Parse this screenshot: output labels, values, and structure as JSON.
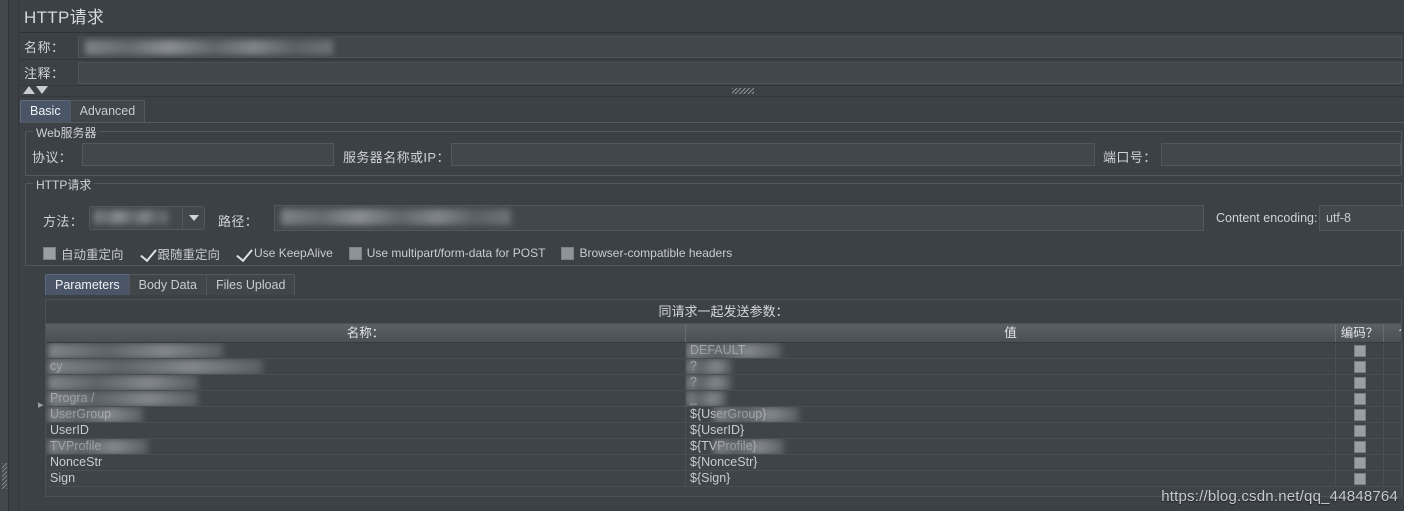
{
  "window": {
    "title": "HTTP请求",
    "watermark": "https://blog.csdn.net/qq_44848764"
  },
  "header": {
    "name_label": "名称：",
    "name_value": "",
    "comment_label": "注释：",
    "comment_value": ""
  },
  "main_tabs": [
    {
      "label": "Basic",
      "selected": true
    },
    {
      "label": "Advanced",
      "selected": false
    }
  ],
  "web_server": {
    "group_title": "Web服务器",
    "protocol_label": "协议：",
    "protocol_value": "",
    "host_label": "服务器名称或IP：",
    "host_value": "",
    "port_label": "端口号：",
    "port_value": ""
  },
  "http_request": {
    "group_title": "HTTP请求",
    "method_label": "方法：",
    "method_value": "",
    "path_label": "路径：",
    "path_value": "",
    "content_encoding_label": "Content encoding:",
    "content_encoding_value": "utf-8"
  },
  "options": [
    {
      "label": "自动重定向",
      "checked": false,
      "cjk": true
    },
    {
      "label": "跟随重定向",
      "checked": true,
      "cjk": true
    },
    {
      "label": "Use KeepAlive",
      "checked": true,
      "cjk": false
    },
    {
      "label": "Use multipart/form-data for POST",
      "checked": false,
      "cjk": false
    },
    {
      "label": "Browser-compatible headers",
      "checked": false,
      "cjk": false
    }
  ],
  "param_tabs": [
    {
      "label": "Parameters",
      "selected": true
    },
    {
      "label": "Body Data",
      "selected": false
    },
    {
      "label": "Files Upload",
      "selected": false
    }
  ],
  "params_table": {
    "caption": "同请求一起发送参数：",
    "columns": [
      "名称：",
      "值",
      "编码？",
      "包含等"
    ],
    "rows": [
      {
        "name": "",
        "value": "DEFAULT",
        "name_blurred": true,
        "value_blurred": true,
        "encode": false,
        "include": true
      },
      {
        "name": "       cy",
        "value": "?",
        "name_blurred": true,
        "value_blurred": true,
        "encode": false,
        "include": true
      },
      {
        "name": "",
        "value": "?",
        "name_blurred": true,
        "value_blurred": true,
        "encode": false,
        "include": true
      },
      {
        "name": "Progra     /",
        "value": "_",
        "name_blurred": true,
        "value_blurred": true,
        "encode": false,
        "include": true
      },
      {
        "name": "UserGroup",
        "value": "${UserGroup}",
        "name_blurred": true,
        "value_blurred": true,
        "encode": false,
        "include": true
      },
      {
        "name": "UserID",
        "value": "${UserID}",
        "name_blurred": false,
        "value_blurred": false,
        "encode": false,
        "include": true
      },
      {
        "name": "TVProfile",
        "value": "${TVProfile}",
        "name_blurred": true,
        "value_blurred": true,
        "encode": false,
        "include": true
      },
      {
        "name": "NonceStr",
        "value": "${NonceStr}",
        "name_blurred": false,
        "value_blurred": false,
        "encode": false,
        "include": true
      },
      {
        "name": "Sign",
        "value": "${Sign}",
        "name_blurred": false,
        "value_blurred": false,
        "encode": false,
        "include": true
      }
    ]
  },
  "colors": {
    "background": "#3c4146",
    "field_bg": "#42474c",
    "tab_selected": "#4a5668",
    "text": "#c9ccd0",
    "border": "#54585d"
  }
}
